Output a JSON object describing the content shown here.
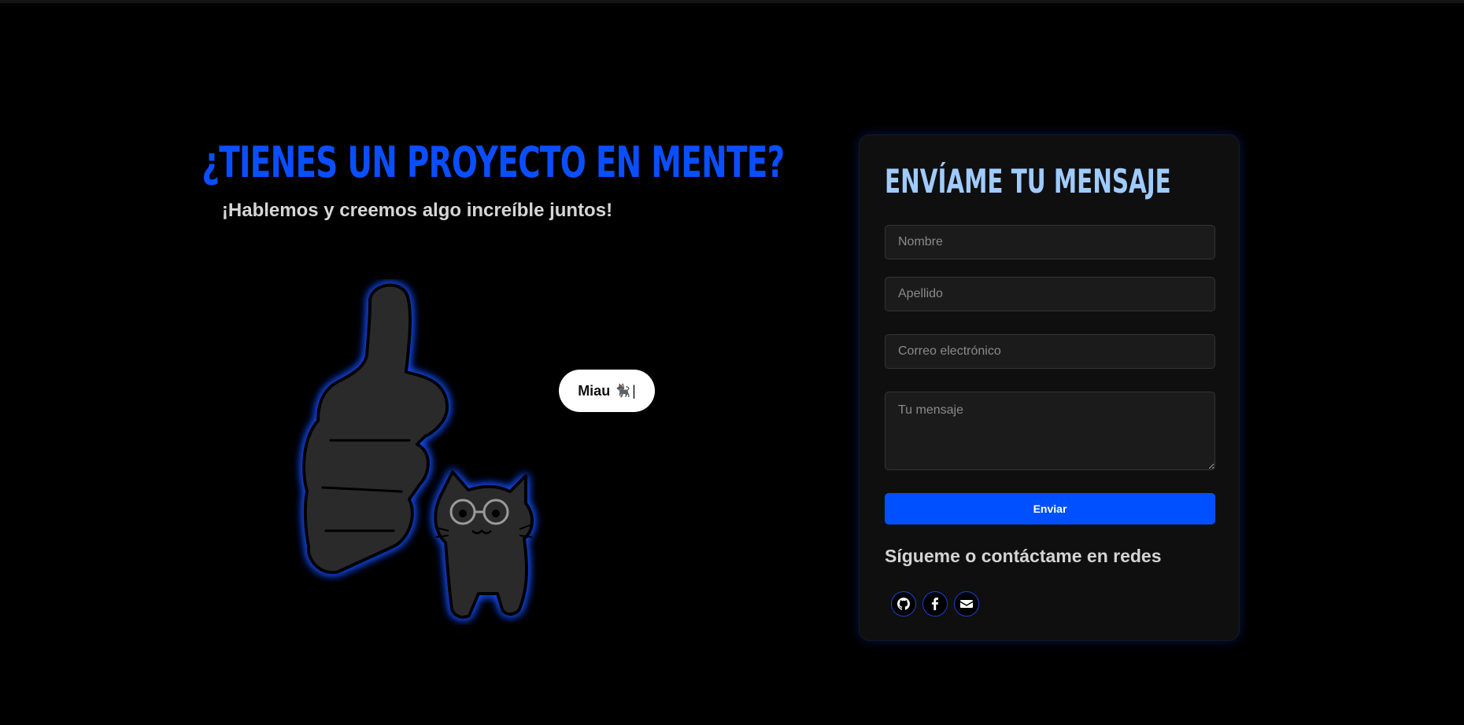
{
  "hero": {
    "title": "¿Tienes un proyecto en mente?",
    "subtitle": "¡Hablemos y creemos algo increíble juntos!"
  },
  "illustration": {
    "icon": "thumbs-up-cat-illustration",
    "bubble_text": "Miau",
    "bubble_emoji": "🐈‍⬛",
    "bubble_cursor": "|"
  },
  "contact_form": {
    "title": "Envíame tu mensaje",
    "fields": {
      "nombre_placeholder": "Nombre",
      "apellido_placeholder": "Apellido",
      "correo_placeholder": "Correo electrónico",
      "mensaje_placeholder": "Tu mensaje"
    },
    "submit_label": "Enviar"
  },
  "social": {
    "heading": "Sígueme o contáctame en redes",
    "links": [
      {
        "icon": "github-icon"
      },
      {
        "icon": "facebook-icon"
      },
      {
        "icon": "email-icon"
      }
    ]
  },
  "colors": {
    "background": "#000000",
    "accent": "#0050ff",
    "title_blue": "#0a4fff",
    "card_title": "#9fcbff"
  }
}
